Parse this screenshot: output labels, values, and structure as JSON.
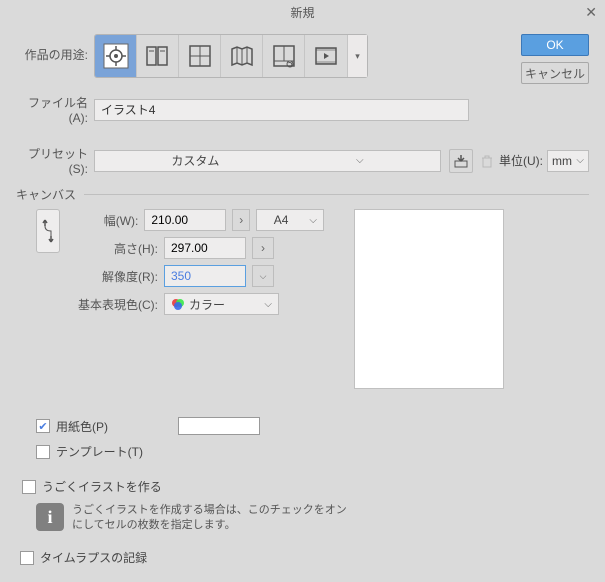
{
  "title": "新規",
  "purpose_label": "作品の用途:",
  "ok_label": "OK",
  "cancel_label": "キャンセル",
  "filename_label": "ファイル名(A):",
  "filename_value": "イラスト4",
  "preset_label": "プリセット(S):",
  "preset_value": "カスタム",
  "unit_label": "単位(U):",
  "unit_value": "mm",
  "canvas_label": "キャンバス",
  "width_label": "幅(W):",
  "width_value": "210.00",
  "height_label": "高さ(H):",
  "height_value": "297.00",
  "resolution_label": "解像度(R):",
  "resolution_value": "350",
  "basic_color_label": "基本表現色(C):",
  "color_mode_value": "カラー",
  "paper_size_value": "A4",
  "paper_color_label": "用紙色(P)",
  "template_label": "テンプレート(T)",
  "animation_label": "うごくイラストを作る",
  "animation_desc": "うごくイラストを作成する場合は、このチェックをオンにしてセルの枚数を指定します。",
  "timelapse_label": "タイムラプスの記録",
  "icons": {
    "purpose1": "illustration-icon",
    "purpose2": "comic-icon",
    "purpose3": "book-icon",
    "purpose4": "spread-icon",
    "purpose5": "animation-icon",
    "purpose6": "movie-icon"
  }
}
